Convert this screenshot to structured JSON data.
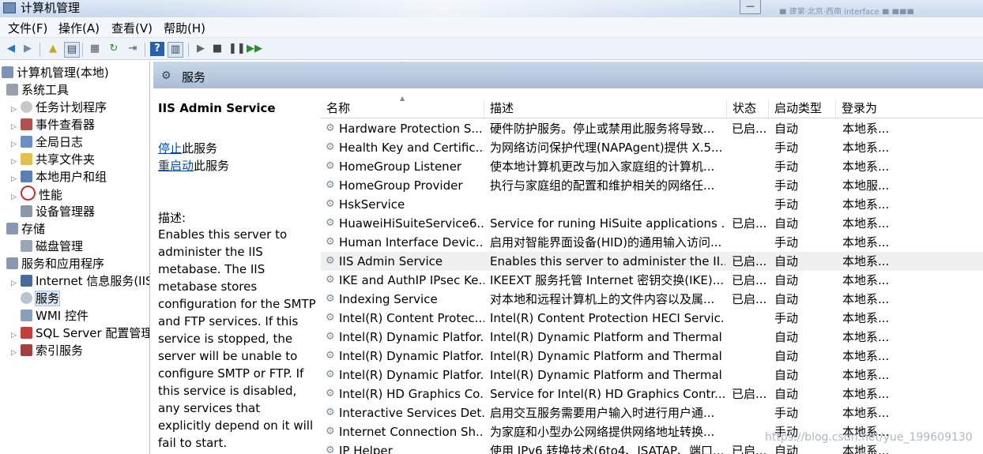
{
  "window": {
    "title": "计算机管理",
    "minimize_glyph": "—",
    "title_right_text": "■ 建第·北京·西南 interface ■ ■■■"
  },
  "menu": [
    {
      "label": "文件(F)"
    },
    {
      "label": "操作(A)"
    },
    {
      "label": "查看(V)"
    },
    {
      "label": "帮助(H)"
    }
  ],
  "tree": {
    "root": "计算机管理(本地)",
    "system_tools": "系统工具",
    "task_scheduler": "任务计划程序",
    "event_viewer": "事件查看器",
    "global_log": "全局日志",
    "shared_folders": "共享文件夹",
    "local_users": "本地用户和组",
    "performance": "性能",
    "device_manager": "设备管理器",
    "storage": "存储",
    "disk_management": "磁盘管理",
    "services_apps": "服务和应用程序",
    "iis": "Internet 信息服务(IIS)管理器",
    "services": "服务",
    "wmi": "WMI 控件",
    "sql_server": "SQL Server 配置管理器",
    "index_service": "索引服务"
  },
  "header": {
    "title": "服务"
  },
  "details": {
    "service_name": "IIS Admin Service",
    "stop_link": "停止",
    "stop_suffix": "此服务",
    "restart_link": "重启动",
    "restart_suffix": "此服务",
    "description_label": "描述:",
    "description": "Enables this server to administer the IIS metabase. The IIS metabase stores configuration for the SMTP and FTP services. If this service is stopped, the server will be unable to configure SMTP or FTP. If this service is disabled, any services that explicitly depend on it will fail to start."
  },
  "columns": {
    "name": "名称",
    "description": "描述",
    "status": "状态",
    "startup": "启动类型",
    "logon": "登录为"
  },
  "rows": [
    {
      "name": "Hardware Protection S...",
      "desc": "硬件防护服务。停止或禁用此服务将导致...",
      "status": "已启...",
      "startup": "自动",
      "logon": "本地系..."
    },
    {
      "name": "Health Key and Certific...",
      "desc": "为网络访问保护代理(NAPAgent)提供 X.5...",
      "status": "",
      "startup": "手动",
      "logon": "本地系..."
    },
    {
      "name": "HomeGroup Listener",
      "desc": "使本地计算机更改与加入家庭组的计算机...",
      "status": "",
      "startup": "手动",
      "logon": "本地系..."
    },
    {
      "name": "HomeGroup Provider",
      "desc": "执行与家庭组的配置和维护相关的网络任...",
      "status": "",
      "startup": "手动",
      "logon": "本地服..."
    },
    {
      "name": "HskService",
      "desc": "",
      "status": "",
      "startup": "手动",
      "logon": "本地系..."
    },
    {
      "name": "HuaweiHiSuiteService6...",
      "desc": "Service for runing HiSuite applications ...",
      "status": "已启...",
      "startup": "自动",
      "logon": "本地系..."
    },
    {
      "name": "Human Interface Devic...",
      "desc": "启用对智能界面设备(HID)的通用输入访问...",
      "status": "",
      "startup": "手动",
      "logon": "本地系..."
    },
    {
      "name": "IIS Admin Service",
      "desc": "Enables this server to administer the II...",
      "status": "已启...",
      "startup": "自动",
      "logon": "本地系..."
    },
    {
      "name": "IKE and AuthIP IPsec Ke...",
      "desc": "IKEEXT 服务托管 Internet 密钥交换(IKE)...",
      "status": "已启...",
      "startup": "自动",
      "logon": "本地系..."
    },
    {
      "name": "Indexing Service",
      "desc": "对本地和远程计算机上的文件内容以及属...",
      "status": "已启...",
      "startup": "自动",
      "logon": "本地系..."
    },
    {
      "name": "Intel(R) Content Protec...",
      "desc": "Intel(R) Content Protection HECI Servic...",
      "status": "",
      "startup": "手动",
      "logon": "本地系..."
    },
    {
      "name": "Intel(R) Dynamic Platfor...",
      "desc": "Intel(R) Dynamic Platform and Thermal ...",
      "status": "",
      "startup": "自动",
      "logon": "本地系..."
    },
    {
      "name": "Intel(R) Dynamic Platfor...",
      "desc": "Intel(R) Dynamic Platform and Thermal ...",
      "status": "",
      "startup": "自动",
      "logon": "本地系..."
    },
    {
      "name": "Intel(R) Dynamic Platfor...",
      "desc": "Intel(R) Dynamic Platform and Thermal ...",
      "status": "",
      "startup": "自动",
      "logon": "本地系..."
    },
    {
      "name": "Intel(R) HD Graphics Co...",
      "desc": "Service for Intel(R) HD Graphics Contr...",
      "status": "已启...",
      "startup": "自动",
      "logon": "本地系..."
    },
    {
      "name": "Interactive Services Det...",
      "desc": "启用交互服务需要用户输入时进行用户通...",
      "status": "",
      "startup": "手动",
      "logon": "本地系..."
    },
    {
      "name": "Internet Connection Sh...",
      "desc": "为家庭和小型办公网络提供网络地址转换...",
      "status": "",
      "startup": "手动",
      "logon": "本地系..."
    },
    {
      "name": "IP Helper",
      "desc": "使用 IPv6 转换技术(6to4、ISATAP、端口...",
      "status": "已启...",
      "startup": "自动",
      "logon": "本地系..."
    }
  ],
  "watermark": "https://blog.csdn.net/yue_199609130",
  "colors": {
    "header_band": "#aabdd6",
    "link": "#0047ab",
    "selected_row": "#f0f0f0"
  }
}
